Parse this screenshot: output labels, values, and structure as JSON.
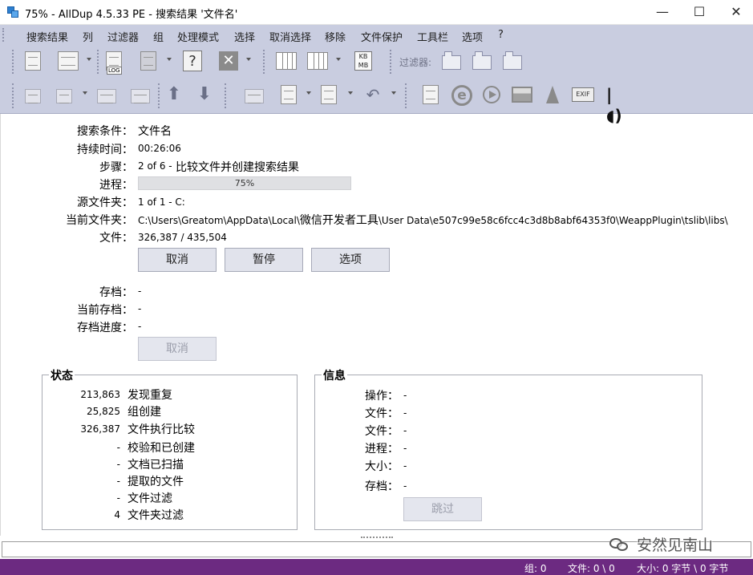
{
  "window": {
    "title": "75% - AllDup 4.5.33 PE - 搜索结果 '文件名'"
  },
  "titlebar_buttons": {
    "minimize": "—",
    "maximize": "☐",
    "close": "✕"
  },
  "menu": [
    "搜索结果",
    "列",
    "过滤器",
    "组",
    "处理模式",
    "选择",
    "取消选择",
    "移除",
    "文件保护",
    "工具栏",
    "选项",
    "?"
  ],
  "toolbar1": {
    "log_label": "LOG",
    "kbmb_label": "KB\nMB",
    "filter_label": "过滤器:",
    "icons": [
      "delete-file-icon",
      "preview-icon",
      "log-icon",
      "save-icon",
      "help-icon",
      "close-icon",
      "columns-icon",
      "column-width-icon",
      "filesize-units-icon",
      "filter-icon",
      "filter-checked-icon",
      "filter-unchecked-icon"
    ]
  },
  "toolbar2": {
    "exif_label": "EXIF",
    "icons": [
      "undo-icon",
      "redo-icon",
      "expand-icon",
      "collapse-icon",
      "move-up-icon",
      "move-down-icon",
      "folder-settings-icon",
      "check-file-icon",
      "file-icon",
      "undo-action-icon",
      "text-viewer-icon",
      "browser-icon",
      "media-player-icon",
      "image-viewer-icon",
      "vlc-icon",
      "exif-icon",
      "audio-icon"
    ]
  },
  "search": {
    "condition_label": "搜索条件：",
    "condition_value": "文件名",
    "duration_label": "持续时间：",
    "duration_value": "00:26:06",
    "step_label": "步骤：",
    "step_value": "2 of 6 - ",
    "step_desc": "比较文件并创建搜索结果",
    "progress_label": "进程：",
    "progress_text": "75%",
    "progress_value": 0.75,
    "source_label": "源文件夹：",
    "source_value": "1 of 1 - C:",
    "current_folder_label": "当前文件夹：",
    "current_folder_value_a": "C:\\Users\\Greatom\\AppData\\Local\\",
    "current_folder_value_b": "微信开发者工具",
    "current_folder_value_c": "\\User Data\\e507c99e58c6fcc4c3d8b8abf64353f0\\WeappPlugin\\tslib\\libs\\",
    "files_label": "文件：",
    "files_value": "326,387 / 435,504"
  },
  "buttons": {
    "cancel": "取消",
    "pause": "暂停",
    "options": "选项",
    "archive_cancel": "取消",
    "skip": "跳过"
  },
  "archive": {
    "archive_label": "存档：",
    "archive_value": "-",
    "current_archive_label": "当前存档：",
    "current_archive_value": "-",
    "archive_progress_label": "存档进度：",
    "archive_progress_value": "-"
  },
  "status_group": {
    "title": "状态",
    "rows": [
      {
        "num": "213,863",
        "label": "发现重复"
      },
      {
        "num": "25,825",
        "label": "组创建"
      },
      {
        "num": "326,387",
        "label": "文件执行比较"
      },
      {
        "num": "-",
        "label": "校验和已创建"
      },
      {
        "num": "-",
        "label": "文档已扫描"
      },
      {
        "num": "-",
        "label": "提取的文件"
      },
      {
        "num": "-",
        "label": "文件过滤"
      },
      {
        "num": "4",
        "label": "文件夹过滤"
      }
    ]
  },
  "info_group": {
    "title": "信息",
    "rows": [
      {
        "label": "操作：",
        "value": "-"
      },
      {
        "label": "文件：",
        "value": "-"
      },
      {
        "label": "文件：",
        "value": "-"
      },
      {
        "label": "进程：",
        "value": "-"
      },
      {
        "label": "大小：",
        "value": "-"
      },
      {
        "label": "存档：",
        "value": "-"
      }
    ]
  },
  "statusbar": {
    "groups": "组: 0",
    "files": "文件: 0 \\ 0",
    "size": "大小: 0 字节 \\ 0 字节",
    "color": "#6c2a81"
  },
  "watermark": {
    "text": "安然见南山"
  }
}
